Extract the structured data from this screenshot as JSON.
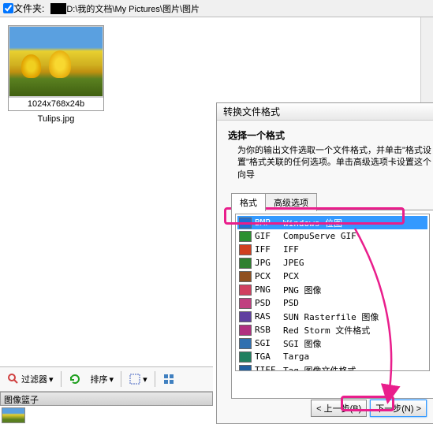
{
  "topbar": {
    "folder_label": "文件夹:",
    "path": "D:\\我的文档\\My Pictures\\图片\\图片"
  },
  "thumbnail": {
    "dimensions": "1024x768x24b",
    "filename": "Tulips.jpg"
  },
  "dialog": {
    "title": "转换文件格式",
    "heading": "选择一个格式",
    "description": "为你的输出文件选取一个文件格式，并单击\"格式设置\"格式关联的任何选项。单击高级选项卡设置这个向导"
  },
  "tabs": {
    "format": "格式",
    "advanced": "高级选项"
  },
  "formats": [
    {
      "ext": "BMP",
      "desc": "Windows 位图",
      "color": "#1e6fd8",
      "selected": true
    },
    {
      "ext": "GIF",
      "desc": "CompuServe GIF",
      "color": "#2a9030"
    },
    {
      "ext": "IFF",
      "desc": "IFF",
      "color": "#d04020"
    },
    {
      "ext": "JPG",
      "desc": "JPEG",
      "color": "#308030"
    },
    {
      "ext": "PCX",
      "desc": "PCX",
      "color": "#905020"
    },
    {
      "ext": "PNG",
      "desc": "PNG 图像",
      "color": "#d04060"
    },
    {
      "ext": "PSD",
      "desc": "PSD",
      "color": "#c04080"
    },
    {
      "ext": "RAS",
      "desc": "SUN Rasterfile 图像",
      "color": "#6040a0"
    },
    {
      "ext": "RSB",
      "desc": "Red Storm 文件格式",
      "color": "#b03080"
    },
    {
      "ext": "SGI",
      "desc": "SGI 图像",
      "color": "#3070b0"
    },
    {
      "ext": "TGA",
      "desc": "Targa",
      "color": "#208060"
    },
    {
      "ext": "TIFF",
      "desc": "Tag 图像文件格式",
      "color": "#2060a0"
    }
  ],
  "buttons": {
    "prev": "< 上一步(B)",
    "next": "下一步(N) >"
  },
  "toolbar": {
    "filter": "过滤器",
    "sort": "排序"
  },
  "basket": {
    "title": "图像篮子"
  }
}
